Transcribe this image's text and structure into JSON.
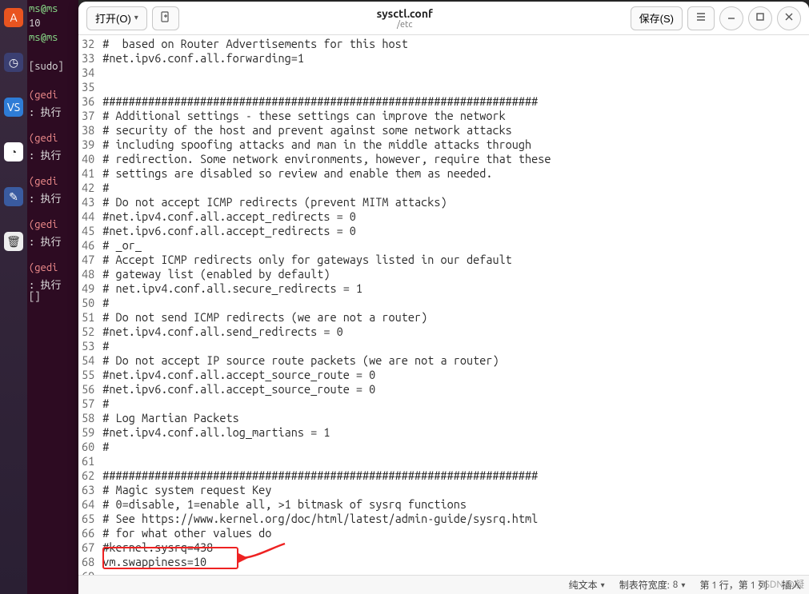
{
  "dock": {
    "items": [
      {
        "name": "store-icon",
        "bg": "#e95420",
        "glyph": "A"
      },
      {
        "name": "ide-icon",
        "bg": "#3b3f72",
        "glyph": "◷"
      },
      {
        "name": "vscode-icon",
        "bg": "#2e7cd6",
        "glyph": "VS"
      },
      {
        "name": "chrome-icon",
        "bg": "#fff",
        "glyph": "◔"
      },
      {
        "name": "gedit-icon",
        "bg": "#3a5ba0",
        "glyph": "✎"
      },
      {
        "name": "trash-icon",
        "bg": "#eee",
        "glyph": "🗑"
      }
    ]
  },
  "terminal": [
    {
      "t": "prompt",
      "text": "ms@ms"
    },
    {
      "t": "plain",
      "text": "10"
    },
    {
      "t": "prompt",
      "text": "ms@ms"
    },
    {
      "t": "plain",
      "text": ""
    },
    {
      "t": "plain",
      "text": "[sudo]"
    },
    {
      "t": "plain",
      "text": ""
    },
    {
      "t": "err",
      "text": "(gedi"
    },
    {
      "t": "plain",
      "text": ": 执行"
    },
    {
      "t": "plain",
      "text": ""
    },
    {
      "t": "err",
      "text": "(gedi"
    },
    {
      "t": "plain",
      "text": ": 执行"
    },
    {
      "t": "plain",
      "text": ""
    },
    {
      "t": "err",
      "text": "(gedi"
    },
    {
      "t": "plain",
      "text": ": 执行"
    },
    {
      "t": "plain",
      "text": ""
    },
    {
      "t": "err",
      "text": "(gedi"
    },
    {
      "t": "plain",
      "text": ": 执行"
    },
    {
      "t": "plain",
      "text": ""
    },
    {
      "t": "err",
      "text": "(gedi"
    },
    {
      "t": "plain",
      "text": ": 执行"
    },
    {
      "t": "plain",
      "text": "[]"
    }
  ],
  "toolbar": {
    "open_label": "打开(O)",
    "save_label": "保存(S)"
  },
  "title": {
    "filename": "sysctl.conf",
    "path": "/etc"
  },
  "lines": [
    {
      "n": 32,
      "t": "#  based on Router Advertisements for this host"
    },
    {
      "n": 33,
      "t": "#net.ipv6.conf.all.forwarding=1"
    },
    {
      "n": 34,
      "t": ""
    },
    {
      "n": 35,
      "t": ""
    },
    {
      "n": 36,
      "t": "###################################################################"
    },
    {
      "n": 37,
      "t": "# Additional settings - these settings can improve the network"
    },
    {
      "n": 38,
      "t": "# security of the host and prevent against some network attacks"
    },
    {
      "n": 39,
      "t": "# including spoofing attacks and man in the middle attacks through"
    },
    {
      "n": 40,
      "t": "# redirection. Some network environments, however, require that these"
    },
    {
      "n": 41,
      "t": "# settings are disabled so review and enable them as needed."
    },
    {
      "n": 42,
      "t": "#"
    },
    {
      "n": 43,
      "t": "# Do not accept ICMP redirects (prevent MITM attacks)"
    },
    {
      "n": 44,
      "t": "#net.ipv4.conf.all.accept_redirects = 0"
    },
    {
      "n": 45,
      "t": "#net.ipv6.conf.all.accept_redirects = 0"
    },
    {
      "n": 46,
      "t": "# _or_"
    },
    {
      "n": 47,
      "t": "# Accept ICMP redirects only for gateways listed in our default"
    },
    {
      "n": 48,
      "t": "# gateway list (enabled by default)"
    },
    {
      "n": 49,
      "t": "# net.ipv4.conf.all.secure_redirects = 1"
    },
    {
      "n": 50,
      "t": "#"
    },
    {
      "n": 51,
      "t": "# Do not send ICMP redirects (we are not a router)"
    },
    {
      "n": 52,
      "t": "#net.ipv4.conf.all.send_redirects = 0"
    },
    {
      "n": 53,
      "t": "#"
    },
    {
      "n": 54,
      "t": "# Do not accept IP source route packets (we are not a router)"
    },
    {
      "n": 55,
      "t": "#net.ipv4.conf.all.accept_source_route = 0"
    },
    {
      "n": 56,
      "t": "#net.ipv6.conf.all.accept_source_route = 0"
    },
    {
      "n": 57,
      "t": "#"
    },
    {
      "n": 58,
      "t": "# Log Martian Packets"
    },
    {
      "n": 59,
      "t": "#net.ipv4.conf.all.log_martians = 1"
    },
    {
      "n": 60,
      "t": "#"
    },
    {
      "n": 61,
      "t": ""
    },
    {
      "n": 62,
      "t": "###################################################################"
    },
    {
      "n": 63,
      "t": "# Magic system request Key"
    },
    {
      "n": 64,
      "t": "# 0=disable, 1=enable all, >1 bitmask of sysrq functions"
    },
    {
      "n": 65,
      "t": "# See https://www.kernel.org/doc/html/latest/admin-guide/sysrq.html"
    },
    {
      "n": 66,
      "t": "# for what other values do"
    },
    {
      "n": 67,
      "t": "#kernel.sysrq=438"
    },
    {
      "n": 68,
      "t": "vm.swappiness=10"
    },
    {
      "n": 69,
      "t": ""
    }
  ],
  "status": {
    "lang": "纯文本",
    "tab_label": "制表符宽度: ",
    "tab_value": "8",
    "pos_label": "第 1 行，第 1 列",
    "ins": "插入"
  },
  "watermark": "CSDN @凝"
}
